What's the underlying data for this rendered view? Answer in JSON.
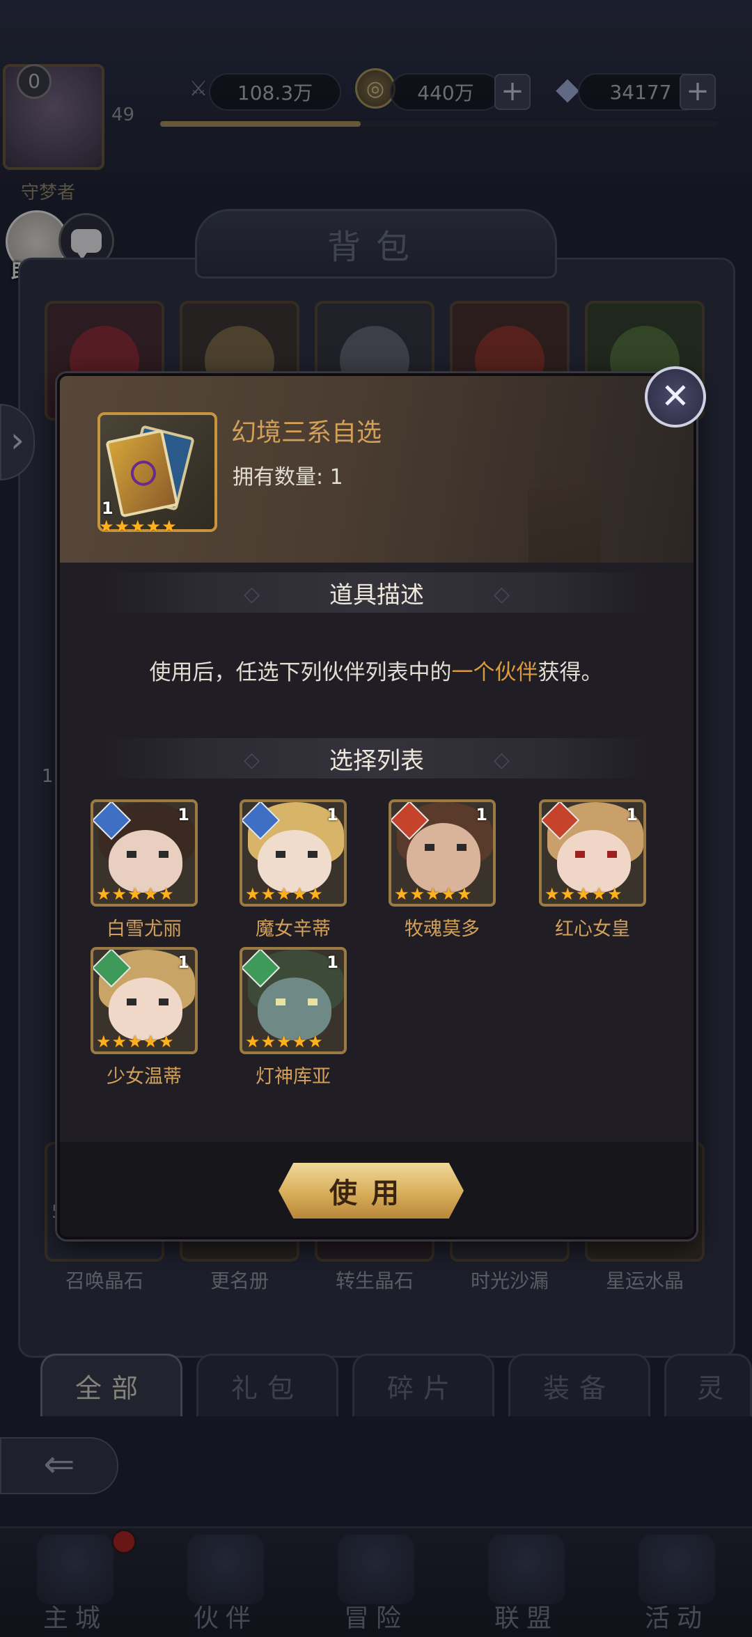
{
  "top_bar": {
    "vip_level": "0",
    "player_level": "49",
    "player_name": "守梦者",
    "xp_progress": 0.36,
    "resources": [
      {
        "icon": "sword-power-icon",
        "value": "108.3万"
      },
      {
        "icon": "gold-coin-icon",
        "value": "440万"
      },
      {
        "icon": "diamond-icon",
        "value": "34177"
      }
    ],
    "helper_label": "助手",
    "chat_label": "聊 天"
  },
  "bag": {
    "title": "背包",
    "row_labels": [
      "召唤晶石",
      "更名册",
      "转生晶石",
      "时光沙漏",
      "星运水晶"
    ],
    "visible_count_5": "5",
    "side_counts": [
      "1"
    ]
  },
  "tabs": [
    {
      "label": "全部",
      "active": true
    },
    {
      "label": "礼包",
      "active": false
    },
    {
      "label": "碎片",
      "active": false
    },
    {
      "label": "装备",
      "active": false
    },
    {
      "label": "灵",
      "active": false
    }
  ],
  "bottom_nav": [
    {
      "label": "主城",
      "icon": "castle-icon"
    },
    {
      "label": "伙伴",
      "icon": "companion-icon"
    },
    {
      "label": "冒险",
      "icon": "compass-icon"
    },
    {
      "label": "联盟",
      "icon": "shield-icon"
    },
    {
      "label": "活动",
      "icon": "cards-icon"
    }
  ],
  "modal": {
    "item_name": "幻境三系自选",
    "owned_label": "拥有数量: 1",
    "item_count": "1",
    "item_stars": 5,
    "description_title": "道具描述",
    "description_before": "使用后，任选下列伙伴列表中的",
    "description_highlight": "一个伙伴",
    "description_after": "获得。",
    "list_title": "选择列表",
    "use_button": "使用",
    "heroes": [
      {
        "name": "白雪尤丽",
        "element": "water",
        "count": "1",
        "stars": 5
      },
      {
        "name": "魔女辛蒂",
        "element": "water",
        "count": "1",
        "stars": 5
      },
      {
        "name": "牧魂莫多",
        "element": "fire",
        "count": "1",
        "stars": 5
      },
      {
        "name": "红心女皇",
        "element": "fire",
        "count": "1",
        "stars": 5
      },
      {
        "name": "少女温蒂",
        "element": "wind",
        "count": "1",
        "stars": 5
      },
      {
        "name": "灯神库亚",
        "element": "wind",
        "count": "1",
        "stars": 5
      }
    ]
  },
  "colors": {
    "accent_gold": "#d3a05a",
    "highlight": "#d89a3c",
    "water": "#3f6fc4",
    "fire": "#c4432a",
    "wind": "#3f9a5a"
  }
}
